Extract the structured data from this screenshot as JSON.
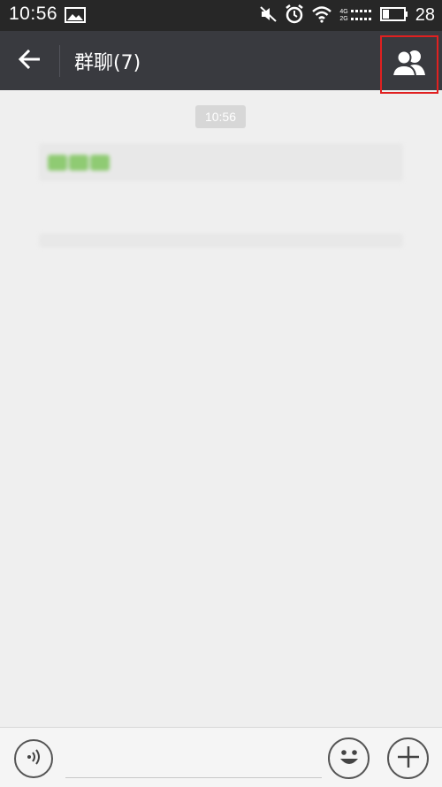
{
  "status_bar": {
    "time": "10:56",
    "battery_level": "28",
    "icons": [
      "image-icon",
      "mute-icon",
      "alarm-icon",
      "wifi-icon",
      "signal-icon",
      "battery-icon"
    ],
    "network_labels": [
      "4G",
      "2G"
    ]
  },
  "header": {
    "title": "群聊(7)",
    "back_icon": "back-arrow-icon",
    "members_icon": "group-members-icon"
  },
  "chat": {
    "timestamp": "10:56",
    "messages": [
      {
        "lines": [
          "",
          "",
          " "
        ]
      },
      {
        "lines": [
          "",
          "",
          ""
        ]
      }
    ]
  },
  "input_bar": {
    "placeholder": "",
    "voice_icon": "voice-input-icon",
    "emoji_icon": "emoji-icon",
    "plus_icon": "plus-icon"
  },
  "colors": {
    "status_bar_bg": "#272727",
    "title_bar_bg": "#393a3f",
    "chat_bg": "#efefef",
    "highlight_border": "#e02020"
  }
}
